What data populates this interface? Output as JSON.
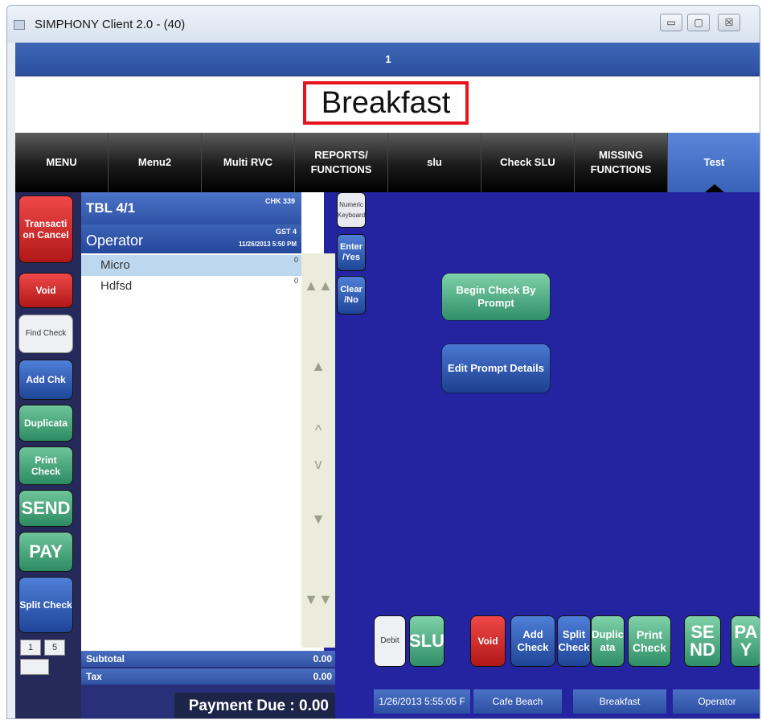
{
  "window": {
    "title": "SIMPHONY Client 2.0 - (40)",
    "min": "▭",
    "max": "▢",
    "close": "☒"
  },
  "topstrip": {
    "label": "1"
  },
  "header": {
    "title": "Breakfast"
  },
  "menu": {
    "tabs": [
      {
        "label": "MENU"
      },
      {
        "label": "Menu2"
      },
      {
        "label": "Multi RVC"
      },
      {
        "label": "REPORTS/ FUNCTIONS"
      },
      {
        "label": "slu"
      },
      {
        "label": "Check SLU"
      },
      {
        "label": "MISSING FUNCTIONS"
      },
      {
        "label": "Test"
      }
    ]
  },
  "left_buttons": {
    "transaction_cancel": "Transacti on Cancel",
    "void": "Void",
    "find_check": "Find Check",
    "add_chk": "Add Chk",
    "duplicate": "Duplicata",
    "print_check": "Print Check",
    "send": "SEND",
    "pay": "PAY",
    "split_check": "Split Check",
    "page_current": "1",
    "page_total": "5",
    "page_extra": ""
  },
  "check": {
    "table": "TBL 4/1",
    "chk_num": "CHK 339",
    "operator": "Operator",
    "guests": "GST 4",
    "datetime": "11/26/2013 5:50 PM",
    "items": [
      {
        "name": "Micro",
        "qty": "0"
      },
      {
        "name": "Hdfsd",
        "qty": "0"
      }
    ],
    "subtotal_label": "Subtotal",
    "subtotal": "0.00",
    "tax_label": "Tax",
    "tax": "0.00",
    "payment_due": "Payment Due :  0.00"
  },
  "scroll": {
    "top": "▲▲",
    "up": "▲",
    "line_up": "^",
    "line_down": "v",
    "down": "▼",
    "bottom": "▼▼"
  },
  "keys": {
    "keyboard": "Numeric Keyboard",
    "enter": "Enter /Yes",
    "clear": "Clear /No"
  },
  "center_buttons": {
    "begin_check": "Begin Check By Prompt",
    "edit_prompt": "Edit Prompt Details"
  },
  "bottom_buttons": {
    "debit": "Debit",
    "slu": "SLU",
    "void": "Void",
    "add_check": "Add Check",
    "split_check": "Split Check",
    "duplicata": "Duplic ata",
    "print_check": "Print Check",
    "send": "SE ND",
    "pay": "PA Y"
  },
  "status_bar": {
    "datetime": "1/26/2013 5:55:05 F",
    "location": "Cafe Beach",
    "period": "Breakfast",
    "operator": "Operator"
  },
  "colors": {
    "background": "#2424a0",
    "highlight_border": "#e8141b",
    "active_tab": "#3a62b8"
  }
}
